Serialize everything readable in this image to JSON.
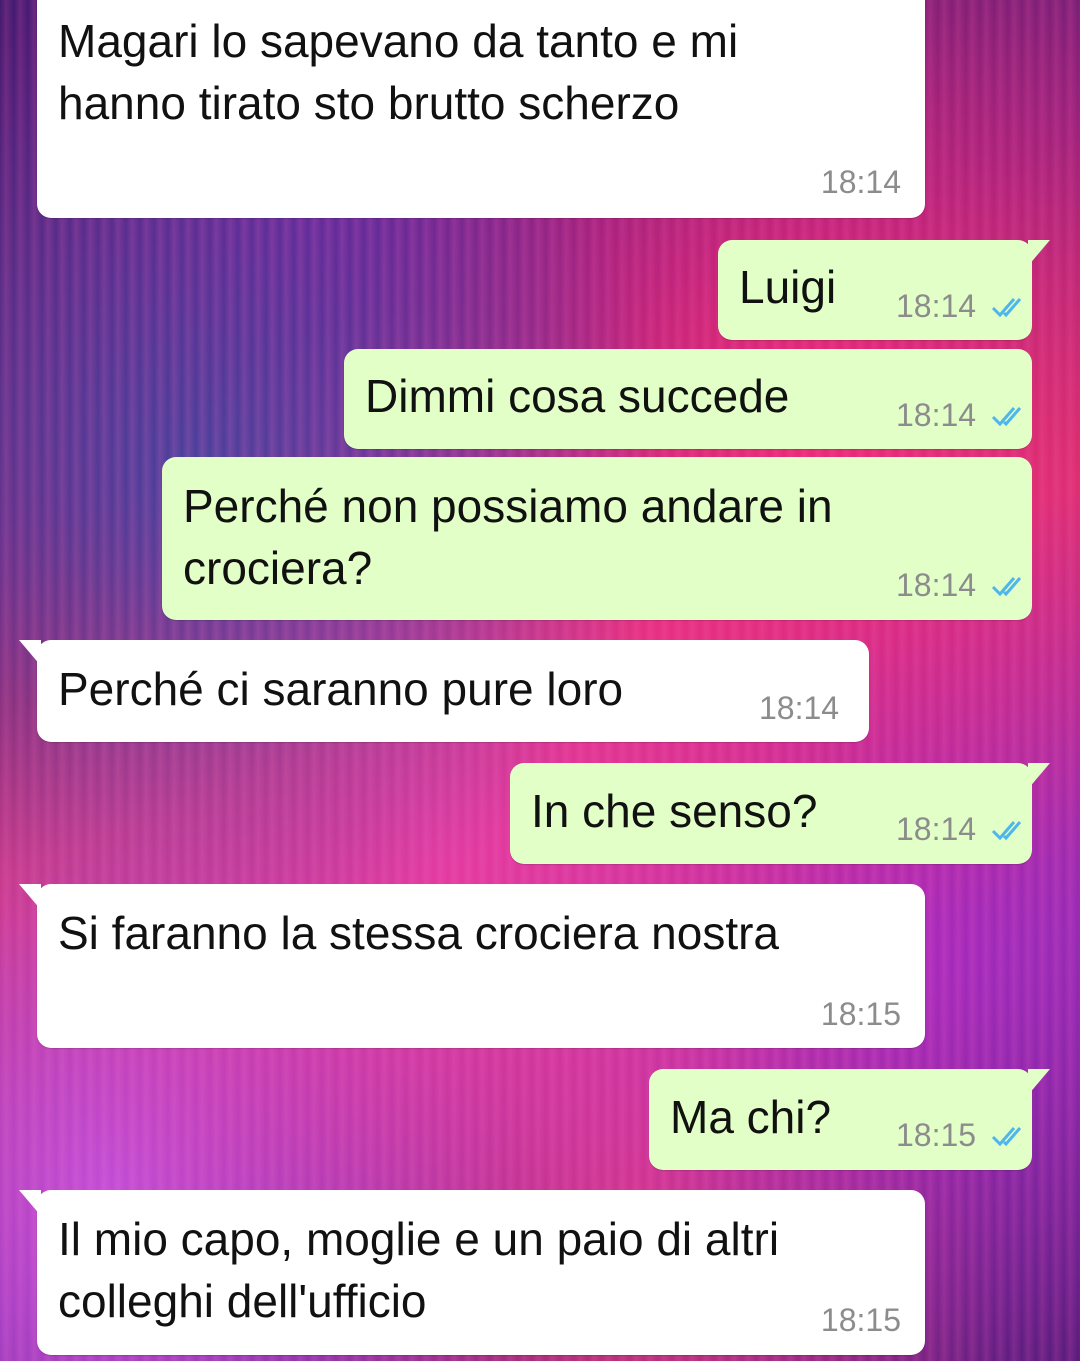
{
  "chat": {
    "accent_read_ticks": "#4fb6ec",
    "incoming_bubble_color": "#ffffff",
    "outgoing_bubble_color": "#e2ffc7",
    "messages": [
      {
        "direction": "incoming",
        "text": "Magari lo sapevano da tanto e mi\nhanno tirato sto brutto scherzo",
        "time": "18:14"
      },
      {
        "direction": "outgoing",
        "text": "Luigi",
        "time": "18:14",
        "status": "read"
      },
      {
        "direction": "outgoing",
        "text": "Dimmi cosa succede",
        "time": "18:14",
        "status": "read"
      },
      {
        "direction": "outgoing",
        "text": "Perché non possiamo andare in\ncrociera?",
        "time": "18:14",
        "status": "read"
      },
      {
        "direction": "incoming",
        "text": "Perché ci saranno pure loro",
        "time": "18:14"
      },
      {
        "direction": "outgoing",
        "text": "In che senso?",
        "time": "18:14",
        "status": "read"
      },
      {
        "direction": "incoming",
        "text": "Si faranno la stessa crociera nostra",
        "time": "18:15"
      },
      {
        "direction": "outgoing",
        "text": "Ma chi?",
        "time": "18:15",
        "status": "read"
      },
      {
        "direction": "incoming",
        "text": "Il mio capo, moglie e un paio di altri\ncolleghi dell'ufficio",
        "time": "18:15"
      }
    ]
  }
}
